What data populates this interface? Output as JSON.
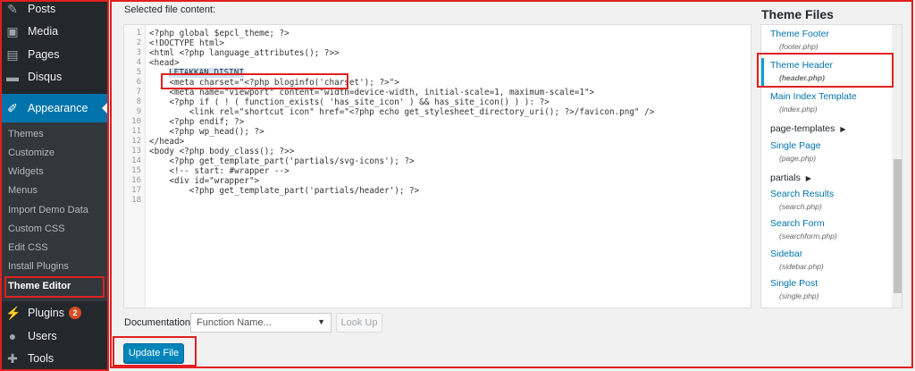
{
  "sidebar": {
    "items": [
      {
        "label": "Posts",
        "icon": "pin-icon"
      },
      {
        "label": "Media",
        "icon": "media-icon"
      },
      {
        "label": "Pages",
        "icon": "page-icon"
      },
      {
        "label": "Disqus",
        "icon": "comment-icon"
      },
      {
        "label": "Appearance",
        "icon": "brush-icon"
      },
      {
        "label": "Plugins",
        "icon": "plugin-icon",
        "badge": "2"
      },
      {
        "label": "Users",
        "icon": "user-icon"
      },
      {
        "label": "Tools",
        "icon": "wrench-icon"
      }
    ],
    "submenu": [
      "Themes",
      "Customize",
      "Widgets",
      "Menus",
      "Import Demo Data",
      "Custom CSS",
      "Edit CSS",
      "Install Plugins",
      "Theme Editor"
    ]
  },
  "editor": {
    "label": "Selected file content:",
    "lines": [
      "<?php global $epcl_theme; ?>",
      "<!DOCTYPE html>",
      "<html <?php language_attributes(); ?>>",
      "<head>",
      "    LETAKKAN DISINI",
      "    <meta charset=\"<?php bloginfo('charset'); ?>\">",
      "    <meta name=\"viewport\" content=\"width=device-width, initial-scale=1, maximum-scale=1\">",
      "    <?php if ( ! ( function_exists( 'has_site_icon' ) && has_site_icon() ) ): ?>",
      "        <link rel=\"shortcut icon\" href=\"<?php echo get_stylesheet_directory_uri(); ?>/favicon.png\" />",
      "    <?php endif; ?>",
      "    <?php wp_head(); ?>",
      "</head>",
      "<body <?php body_class(); ?>>",
      "    <?php get_template_part('partials/svg-icons'); ?>",
      "    <!-- start: #wrapper -->",
      "    <div id=\"wrapper\">",
      "        <?php get_template_part('partials/header'); ?>",
      ""
    ]
  },
  "documentation": {
    "label": "Documentation:",
    "select_value": "Function Name...",
    "lookup_label": "Look Up"
  },
  "update_button": "Update File",
  "theme_files": {
    "title": "Theme Files",
    "entries": [
      {
        "name": "Theme Footer",
        "file": "(footer.php)"
      },
      {
        "name": "Theme Header",
        "file": "(header.php)"
      },
      {
        "name": "Main Index Template",
        "file": "(index.php)"
      },
      {
        "folder": "page-templates"
      },
      {
        "name": "Single Page",
        "file": "(page.php)"
      },
      {
        "folder": "partials"
      },
      {
        "name": "Search Results",
        "file": "(search.php)"
      },
      {
        "name": "Search Form",
        "file": "(searchform.php)"
      },
      {
        "name": "Sidebar",
        "file": "(sidebar.php)"
      },
      {
        "name": "Single Post",
        "file": "(single.php)"
      }
    ]
  },
  "colors": {
    "sidebar_bg": "#23282d",
    "accent": "#0073aa",
    "highlight": "#e0201e"
  }
}
